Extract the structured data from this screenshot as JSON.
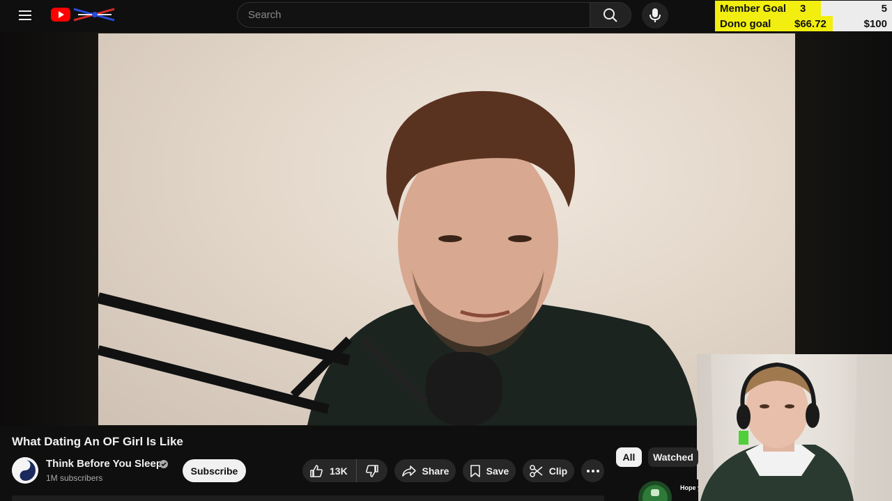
{
  "header": {
    "search_placeholder": "Search"
  },
  "icons": {
    "menu": "hamburger-menu-icon",
    "logo": "youtube-logo-icon",
    "search": "search-icon",
    "mic": "microphone-icon"
  },
  "goals": {
    "member": {
      "label": "Member Goal",
      "current": "3",
      "target": "5",
      "progress": 0.6
    },
    "dono": {
      "label": "Dono goal",
      "current": "$66.72",
      "target": "$100",
      "progress": 0.667
    }
  },
  "video": {
    "title": "What Dating An OF Girl Is Like"
  },
  "channel": {
    "name": "Think Before You Sleep",
    "subscribers": "1M subscribers",
    "verified": true
  },
  "actions": {
    "subscribe": "Subscribe",
    "likes": "13K",
    "share": "Share",
    "save": "Save",
    "clip": "Clip"
  },
  "chips": [
    "All",
    "Watched"
  ],
  "recommendation": {
    "thumb_text": "Hope y"
  },
  "colors": {
    "background": "#0f0f0f",
    "goal_fill": "#f2ee10",
    "youtube_red": "#ff0000"
  }
}
